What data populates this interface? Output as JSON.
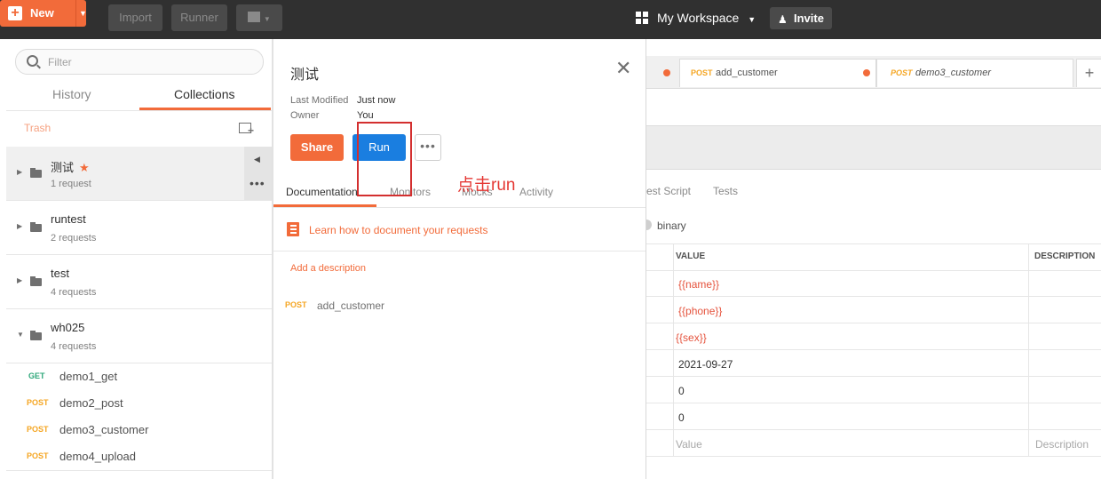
{
  "topbar": {
    "new_label": "New",
    "import_label": "Import",
    "runner_label": "Runner",
    "workspace_label": "My Workspace",
    "invite_label": "Invite"
  },
  "sidebar": {
    "search_placeholder": "Filter",
    "tabs": [
      "History",
      "Collections"
    ],
    "active_tab": "Collections",
    "trash_label": "Trash",
    "collections": [
      {
        "name": "测试",
        "count": "1 request",
        "starred": true
      },
      {
        "name": "runtest",
        "count": "2 requests"
      },
      {
        "name": "test",
        "count": "4 requests"
      },
      {
        "name": "wh025",
        "count": "4 requests"
      }
    ],
    "requests": [
      {
        "method": "GET",
        "name": "demo1_get"
      },
      {
        "method": "POST",
        "name": "demo2_post"
      },
      {
        "method": "POST",
        "name": "demo3_customer"
      },
      {
        "method": "POST",
        "name": "demo4_upload"
      }
    ]
  },
  "popover": {
    "title": "测试",
    "last_modified_label": "Last Modified",
    "last_modified_value": "Just now",
    "owner_label": "Owner",
    "owner_value": "You",
    "share_label": "Share",
    "run_label": "Run",
    "tabs": [
      "Documentation",
      "Monitors",
      "Mocks",
      "Activity"
    ],
    "learn_link": "Learn how to document your requests",
    "add_description": "Add a description",
    "request": {
      "method": "POST",
      "name": "add_customer"
    }
  },
  "right_panel": {
    "tabs": [
      {
        "method": "POST",
        "name": "add_customer"
      },
      {
        "method": "POST",
        "name": "demo3_customer"
      }
    ],
    "sub_tabs": [
      "est Script",
      "Tests"
    ],
    "body_mode": "binary",
    "table_headers": {
      "value": "VALUE",
      "description": "DESCRIPTION"
    },
    "values": [
      "{{name}}",
      "{{phone}}",
      "{{sex}}",
      "2021-09-27",
      "0",
      "0"
    ],
    "value_placeholder": "Value",
    "description_placeholder": "Description"
  },
  "annotation": {
    "text": "点击run"
  },
  "colors": {
    "accent": "#f26b3a",
    "run_blue": "#1a7ee0",
    "annotation_red": "#d32f2f",
    "get_green": "#2ea77a",
    "post_orange": "#f5a623"
  }
}
